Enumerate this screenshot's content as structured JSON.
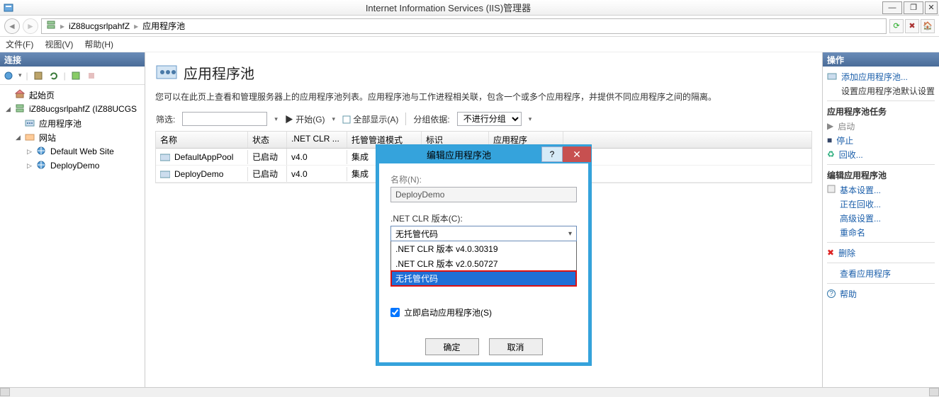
{
  "window": {
    "title": "Internet Information Services (IIS)管理器"
  },
  "breadcrumb": {
    "host": "iZ88ucgsrlpahfZ",
    "node": "应用程序池"
  },
  "menu": {
    "file": "文件(F)",
    "view": "视图(V)",
    "help": "帮助(H)"
  },
  "panels": {
    "connections": "连接",
    "actions": "操作"
  },
  "tree": {
    "start": "起始页",
    "host": "iZ88ucgsrlpahfZ (IZ88UCGS",
    "apppools": "应用程序池",
    "sites": "网站",
    "site1": "Default Web Site",
    "site2": "DeployDemo"
  },
  "center": {
    "title": "应用程序池",
    "desc": "您可以在此页上查看和管理服务器上的应用程序池列表。应用程序池与工作进程相关联，包含一个或多个应用程序，并提供不同应用程序之间的隔离。",
    "filter_label": "筛选:",
    "start_label": "开始(G)",
    "showall": "全部显示(A)",
    "groupby": "分组依据:",
    "group_value": "不进行分组",
    "cols": {
      "name": "名称",
      "status": "状态",
      "clr": ".NET CLR ...",
      "pipeline": "托管管道模式",
      "ident": "标识",
      "apps": "应用程序"
    },
    "rows": [
      {
        "name": "DefaultAppPool",
        "status": "已启动",
        "clr": "v4.0",
        "pipeline": "集成"
      },
      {
        "name": "DeployDemo",
        "status": "已启动",
        "clr": "v4.0",
        "pipeline": "集成"
      }
    ]
  },
  "actions": {
    "add": "添加应用程序池...",
    "setdefault": "设置应用程序池默认设置",
    "tasks_header": "应用程序池任务",
    "start": "启动",
    "stop": "停止",
    "recycle": "回收...",
    "edit_header": "编辑应用程序池",
    "basic": "基本设置...",
    "recycling": "正在回收...",
    "advanced": "高级设置...",
    "rename": "重命名",
    "delete": "删除",
    "viewapps": "查看应用程序",
    "help": "帮助"
  },
  "dialog": {
    "title": "编辑应用程序池",
    "name_label": "名称(N):",
    "name_value": "DeployDemo",
    "clr_label": ".NET CLR 版本(C):",
    "clr_selected": "无托管代码",
    "clr_options": [
      ".NET CLR 版本 v4.0.30319",
      ".NET CLR 版本 v2.0.50727",
      "无托管代码"
    ],
    "autostart": "立即启动应用程序池(S)",
    "ok": "确定",
    "cancel": "取消"
  }
}
